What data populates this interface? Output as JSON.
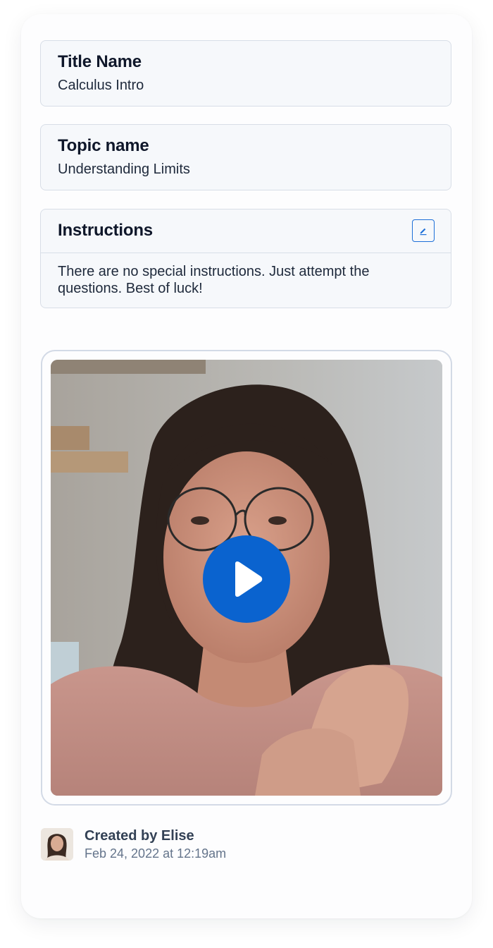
{
  "title_field": {
    "label": "Title Name",
    "value": "Calculus Intro"
  },
  "topic_field": {
    "label": "Topic name",
    "value": "Understanding Limits"
  },
  "instructions": {
    "label": "Instructions",
    "text": "There are no special instructions. Just attempt the questions. Best of luck!",
    "edit_icon": "edit-pencil-icon"
  },
  "video": {
    "play_icon": "play-icon"
  },
  "creator": {
    "name_line": "Created by Elise",
    "date": "Feb 24, 2022 at 12:19am"
  },
  "colors": {
    "accent": "#0a63cf",
    "border": "#d8dee7",
    "field_bg": "#f6f8fb",
    "heading": "#0f172a",
    "muted": "#64748b"
  }
}
